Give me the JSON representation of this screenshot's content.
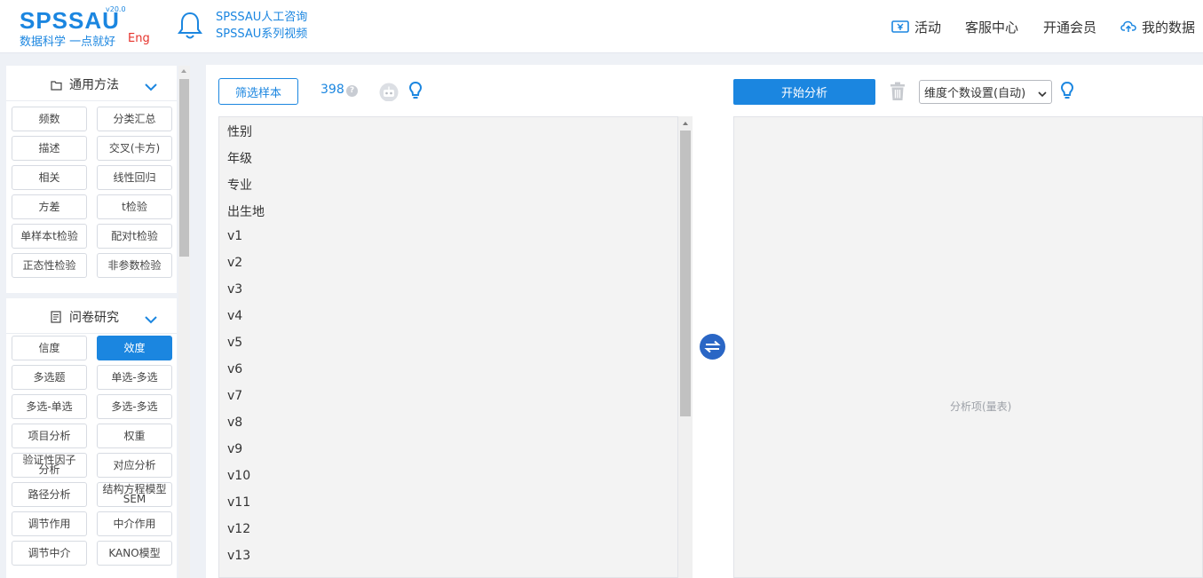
{
  "header": {
    "logo_text": "SPSSAU",
    "logo_version": "v20.0",
    "logo_tagline": "数据科学  一点就好",
    "logo_lang": "Eng",
    "notice_lines": [
      "SPSSAU人工咨询",
      "SPSSAU系列视频"
    ],
    "nav": {
      "activity": "活动",
      "service": "客服中心",
      "member": "开通会员",
      "my_data": "我的数据"
    }
  },
  "sidebar": {
    "general": {
      "title": "通用方法",
      "buttons": [
        "频数",
        "分类汇总",
        "描述",
        "交叉(卡方)",
        "相关",
        "线性回归",
        "方差",
        "t检验",
        "单样本t检验",
        "配对t检验",
        "正态性检验",
        "非参数检验"
      ]
    },
    "survey": {
      "title": "问卷研究",
      "active": "效度",
      "buttons": [
        "信度",
        "效度",
        "多选题",
        "单选-多选",
        "多选-单选",
        "多选-多选",
        "项目分析",
        "权重",
        "验证性因子|分析",
        "对应分析",
        "路径分析",
        "结构方程模型|SEM",
        "调节作用",
        "中介作用",
        "调节中介",
        "KANO模型"
      ]
    }
  },
  "main": {
    "filter_button": "筛选样本",
    "sample_count": "398",
    "help_glyph": "?",
    "variables": [
      "性别",
      "年级",
      "专业",
      "出生地",
      "v1",
      "v2",
      "v3",
      "v4",
      "v5",
      "v6",
      "v7",
      "v8",
      "v9",
      "v10",
      "v11",
      "v12",
      "v13"
    ],
    "start_button": "开始分析",
    "dimension_select": "维度个数设置(自动)",
    "analysis_placeholder": "分析项(量表)"
  },
  "colors": {
    "brand": "#1b86e0",
    "eng": "#e6322b",
    "swap": "#2a66c5"
  }
}
